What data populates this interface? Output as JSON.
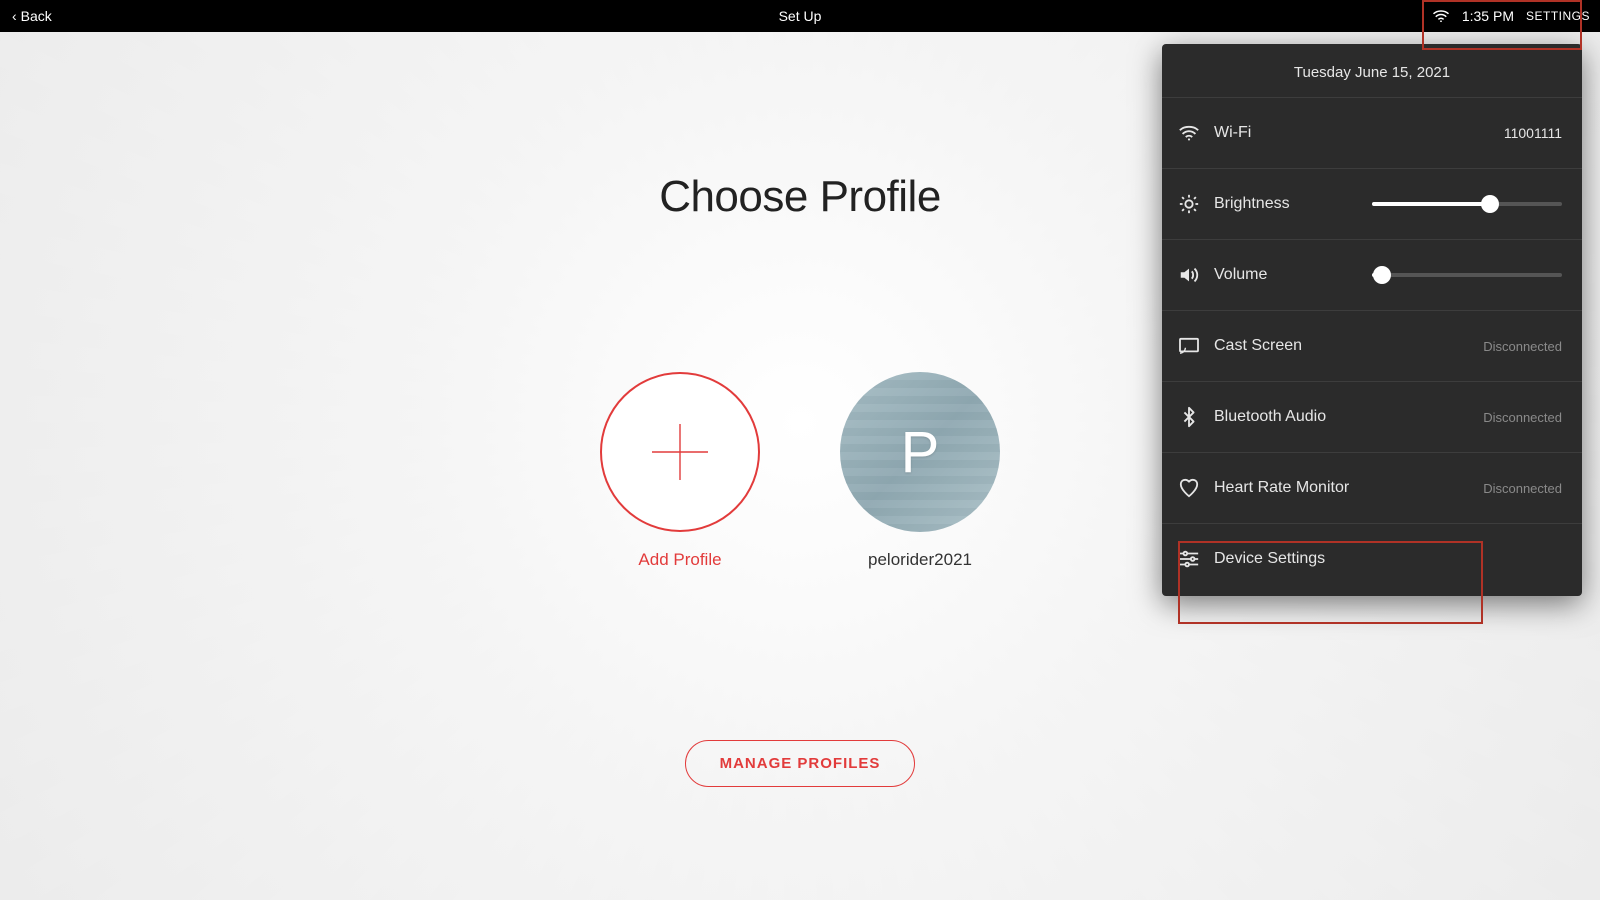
{
  "colors": {
    "accent": "#e23b3b",
    "panel_bg": "#2b2b2b"
  },
  "statusbar": {
    "back_label": "Back",
    "title": "Set Up",
    "time": "1:35 PM",
    "settings_label": "SETTINGS"
  },
  "main": {
    "heading": "Choose Profile",
    "add_profile_label": "Add Profile",
    "profiles": [
      {
        "initial": "P",
        "name": "pelorider2021"
      }
    ],
    "manage_button": "MANAGE PROFILES"
  },
  "panel": {
    "date": "Tuesday June 15, 2021",
    "wifi": {
      "label": "Wi-Fi",
      "value": "11001111"
    },
    "brightness": {
      "label": "Brightness",
      "percent": 62
    },
    "volume": {
      "label": "Volume",
      "percent": 5
    },
    "cast": {
      "label": "Cast Screen",
      "status": "Disconnected"
    },
    "bluetooth": {
      "label": "Bluetooth Audio",
      "status": "Disconnected"
    },
    "hrm": {
      "label": "Heart Rate Monitor",
      "status": "Disconnected"
    },
    "device": {
      "label": "Device Settings"
    }
  }
}
